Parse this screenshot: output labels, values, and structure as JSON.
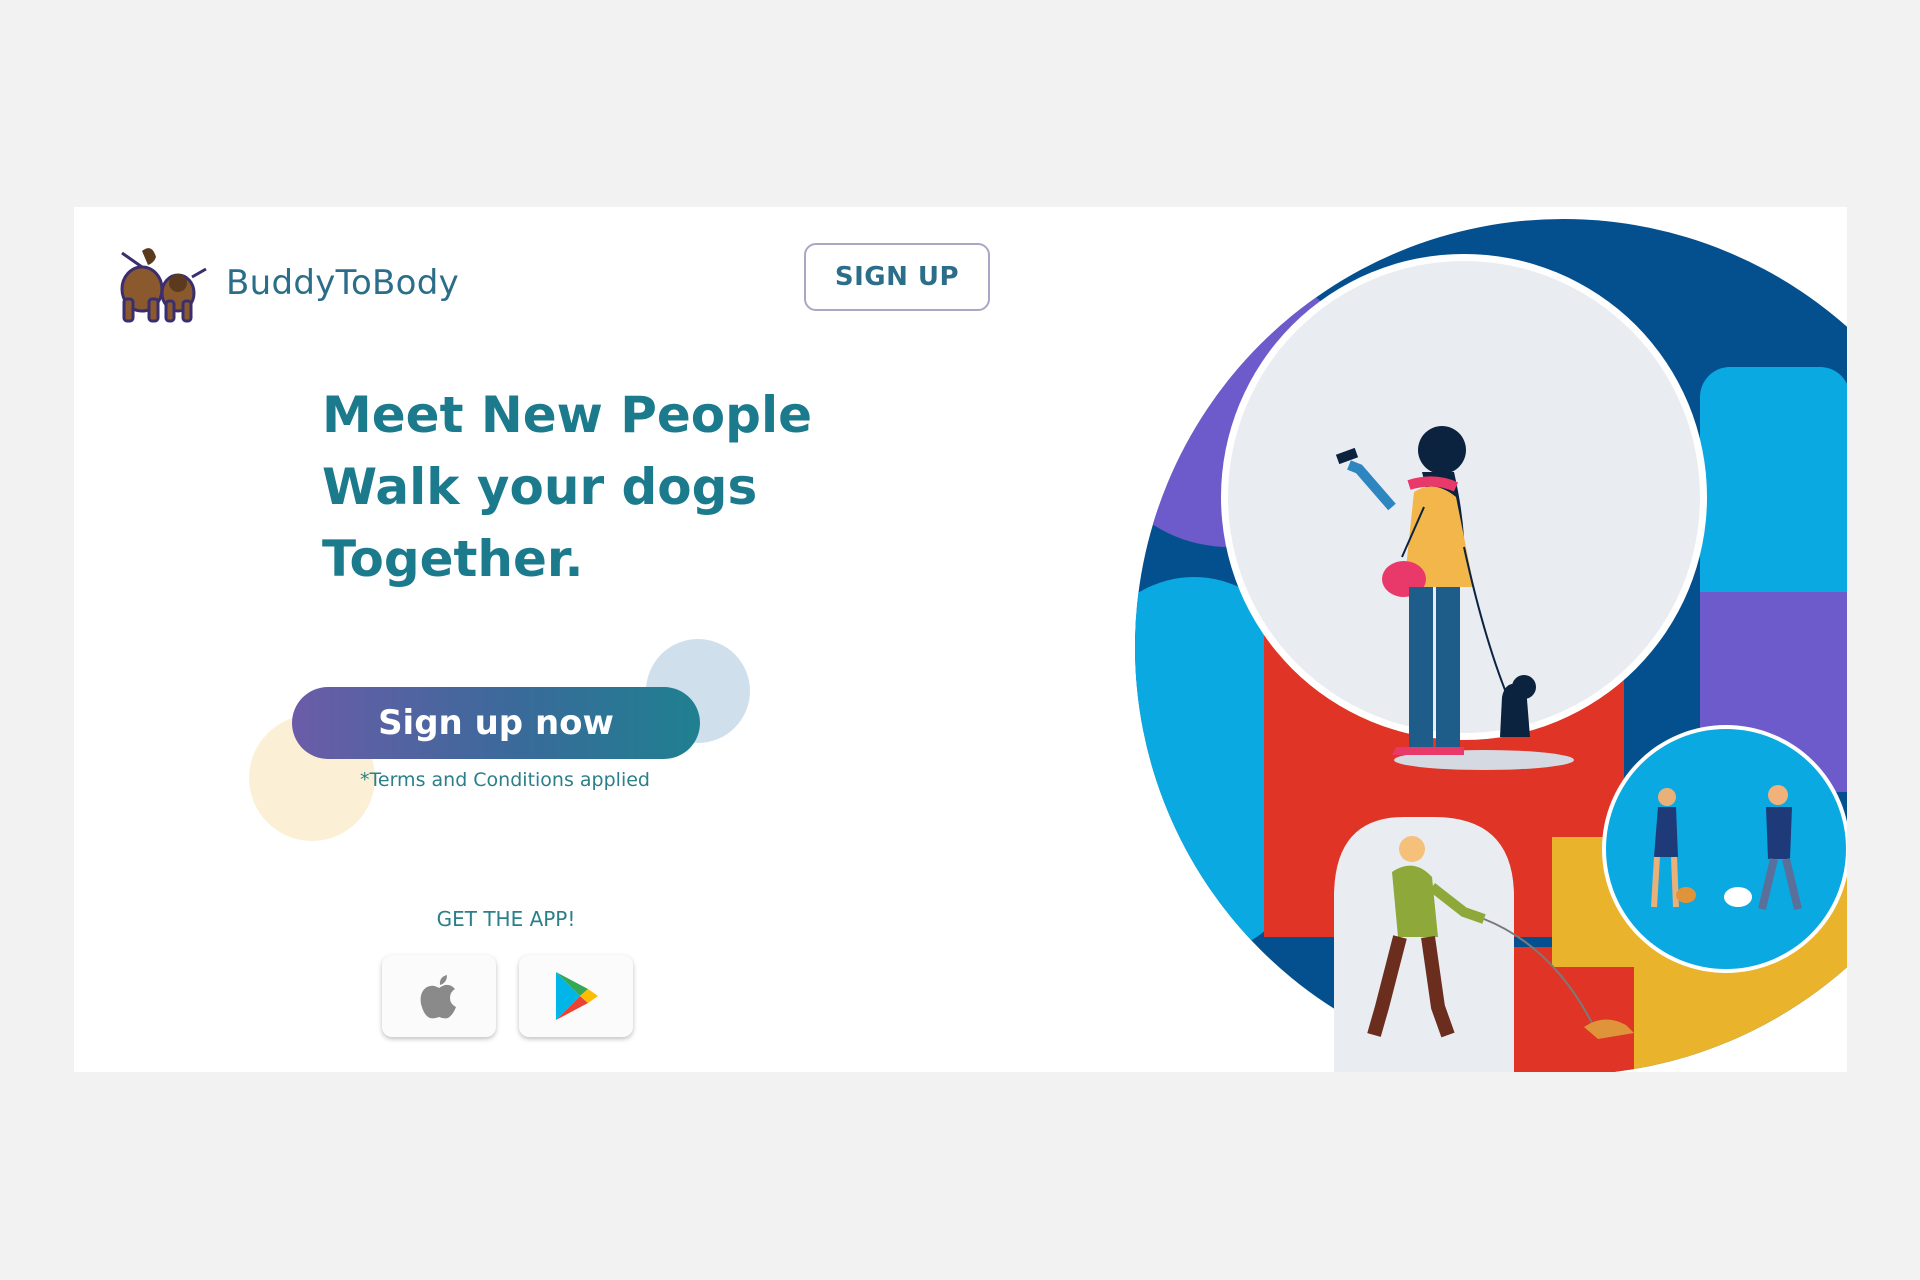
{
  "header": {
    "brand_name": "BuddyToBody",
    "signup_label": "SIGN UP"
  },
  "hero": {
    "lines": [
      "Meet New People",
      "Walk your dogs",
      "Together."
    ]
  },
  "cta": {
    "label": "Sign up now",
    "terms": "*Terms and Conditions applied"
  },
  "app": {
    "heading": "GET THE APP!",
    "stores": [
      {
        "icon": "apple-icon"
      },
      {
        "icon": "google-play-icon"
      }
    ]
  },
  "colors": {
    "page_bg": "#f2f2f2",
    "accent_teal": "#1b7a8c",
    "brand_text": "#2c6e8a",
    "navy": "#04508f",
    "sky_blue": "#0aa9e1",
    "purple": "#6e5bcb",
    "red": "#e03427",
    "yellow": "#e9b32b"
  }
}
